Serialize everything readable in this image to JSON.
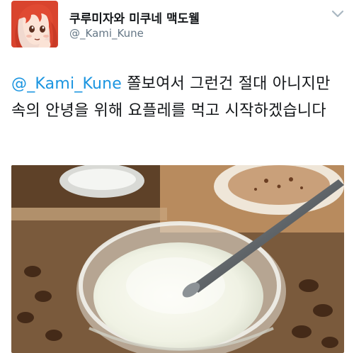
{
  "user": {
    "display_name": "쿠루미자와 미쿠네 맥도웰",
    "handle": "@_Kami_Kune",
    "avatar_icon": "anime-character-avatar"
  },
  "tweet": {
    "mention": "@_Kami_Kune",
    "text_after_mention": " 쫄보여서 그런건 절대 아니지만 속의 안녕을 위해 요플레를 먹고 시작하겠습니다"
  },
  "menu_icon": "chevron-down-icon",
  "media": {
    "description_icon": "yogurt-cup-photo"
  },
  "colors": {
    "mention": "#1b95e0",
    "handle": "#657786",
    "text": "#14171a"
  }
}
